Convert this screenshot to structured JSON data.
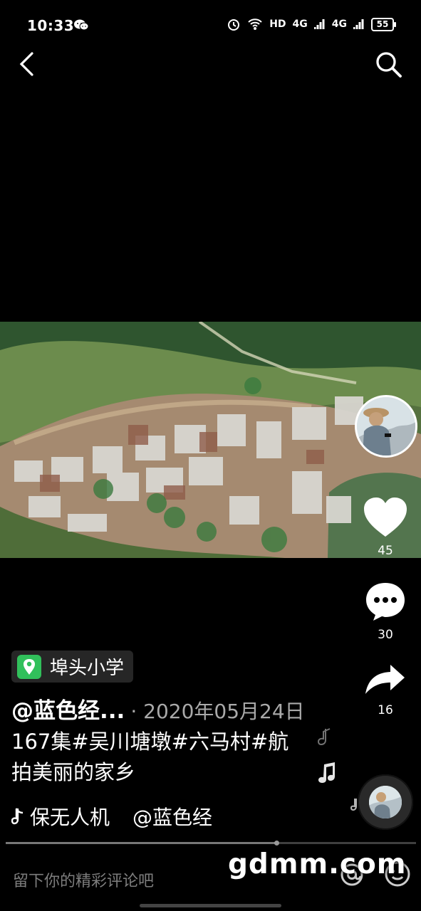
{
  "status_bar": {
    "time": "10:33",
    "network": "HD",
    "signal_1": "4G",
    "signal_2": "4G",
    "battery": "55"
  },
  "video": {
    "location": "埠头小学",
    "author": "@蓝色经...",
    "date": "· 2020年05月24日",
    "caption": "167集#吴川塘墩#六马村#航拍美丽的家乡",
    "music_title": "保无人机",
    "music_author": "@蓝色经",
    "progress": 0.66
  },
  "actions": {
    "likes": "45",
    "comments": "30",
    "shares": "16"
  },
  "comment_bar": {
    "placeholder": "留下你的精彩评论吧"
  },
  "watermark": "gdmm.com",
  "icons": {
    "back": "back-icon",
    "search": "search-icon",
    "like": "heart-icon",
    "comment": "comment-icon",
    "share": "share-icon",
    "location": "location-pin-icon",
    "music": "music-note-icon",
    "at": "at-icon",
    "emoji": "emoji-icon"
  },
  "colors": {
    "background": "#000000",
    "location_accent": "#31c05b",
    "muted_text": "#a9a9a9"
  }
}
